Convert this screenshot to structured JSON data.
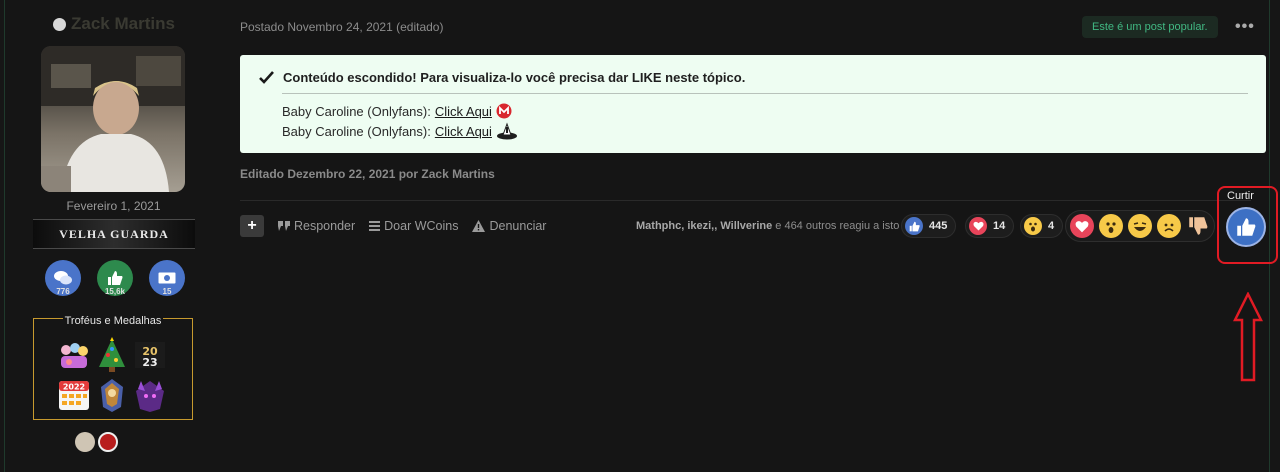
{
  "author": {
    "name": "Zack Martins",
    "join_date": "Fevereiro 1, 2021",
    "rank": "VELHA GUARDA",
    "stats": [
      {
        "icon": "chat-bubbles-icon",
        "value": "776",
        "color": "#4a74c9"
      },
      {
        "icon": "thumbs-up-icon",
        "value": "15,6k",
        "color": "#2d8a4d"
      },
      {
        "icon": "money-icon",
        "value": "15",
        "color": "#4a74c9"
      }
    ],
    "trophies_title": "Troféus e Medalhas",
    "trophies": [
      "party-people-icon",
      "christmas-tree-icon",
      "year-2023-icon",
      "calendar-2022-icon",
      "armored-knight-icon",
      "purple-demon-icon"
    ],
    "badges": [
      "stone-badge-icon",
      "ruby-badge-icon"
    ]
  },
  "post": {
    "meta": "Postado Novembro 24, 2021 (editado)",
    "popular_label": "Este é um post popular.",
    "more_label": "•••",
    "hidden_title": "Conteúdo escondido! Para visualiza-lo você precisa dar LIKE neste tópico.",
    "links": [
      {
        "prefix": "Baby Caroline (Onlyfans): ",
        "link_text": "Click Aqui",
        "icon": "mega-icon"
      },
      {
        "prefix": "Baby Caroline (Onlyfans): ",
        "link_text": "Click Aqui",
        "icon": "mediafire-icon"
      }
    ],
    "edited": "Editado Dezembro 22, 2021 por Zack Martins"
  },
  "actions": {
    "plus": "+",
    "reply": "Responder",
    "donate": "Doar WCoins",
    "report": "Denunciar"
  },
  "reactions": {
    "users_bold": "Mathphc, ikezi,, Willverine",
    "users_rest": " e 464 outros reagiu a isto",
    "counts": [
      {
        "icon": "like-icon",
        "value": "445"
      },
      {
        "icon": "love-icon",
        "value": "14"
      },
      {
        "icon": "wow-icon",
        "value": "4"
      }
    ],
    "tray": [
      "heart-icon",
      "surprised-face-icon",
      "laughing-face-icon",
      "sad-face-icon",
      "thumbs-down-icon"
    ],
    "curtir_label": "Curtir"
  },
  "colors": {
    "accent_green": "#41b883",
    "highlight_red": "#e11b24",
    "like_blue": "#3d70c4"
  }
}
